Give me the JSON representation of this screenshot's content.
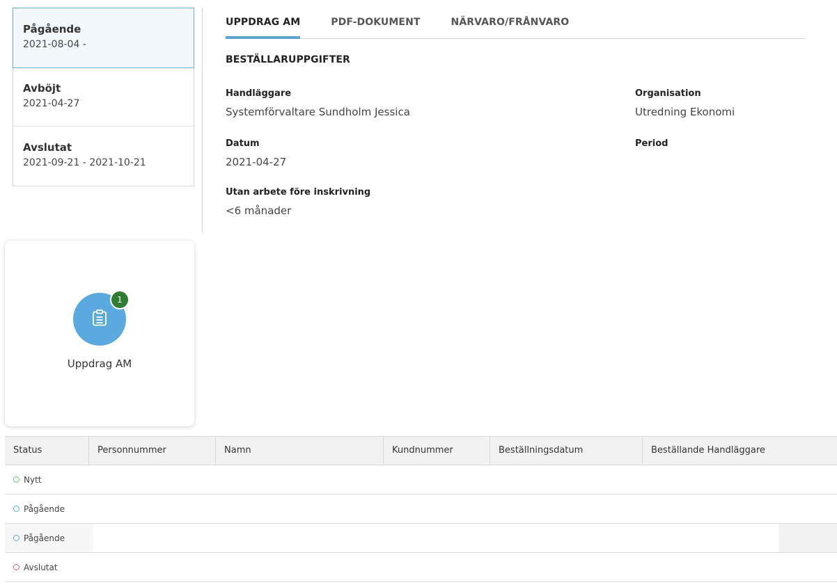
{
  "status_list": [
    {
      "title": "Pågående",
      "date": "2021-08-04 -"
    },
    {
      "title": "Avböjt",
      "date": "2021-04-27"
    },
    {
      "title": "Avslutat",
      "date": "2021-09-21 - 2021-10-21"
    }
  ],
  "tabs": [
    {
      "label": "UPPDRAG AM"
    },
    {
      "label": "PDF-DOKUMENT"
    },
    {
      "label": "NÄRVARO/FRÅNVARO"
    }
  ],
  "section_title": "BESTÄLLARUPPGIFTER",
  "fields": {
    "handlaggare": {
      "label": "Handläggare",
      "value": "Systemförvaltare Sundholm Jessica"
    },
    "organisation": {
      "label": "Organisation",
      "value": "Utredning Ekonomi"
    },
    "datum": {
      "label": "Datum",
      "value": "2021-04-27"
    },
    "period": {
      "label": "Period",
      "value": ""
    },
    "utan_arbete": {
      "label": "Utan arbete före inskrivning",
      "value": "<6 månader"
    }
  },
  "card": {
    "label": "Uppdrag AM",
    "badge": "1",
    "icon": "clipboard-icon"
  },
  "table": {
    "headers": [
      "Status",
      "Personnummer",
      "Namn",
      "Kundnummer",
      "Beställningsdatum",
      "Beställande Handläggare"
    ],
    "rows": [
      {
        "status": "Nytt",
        "color": "#6cc46c"
      },
      {
        "status": "Pågående",
        "color": "#5aaee0"
      },
      {
        "status": "Pågående",
        "color": "#5aaee0"
      },
      {
        "status": "Avslutat",
        "color": "#e0608a"
      }
    ]
  },
  "colors": {
    "accent": "#5aa4cf",
    "badge": "#2f7d32",
    "card_circle": "#5aa9df"
  }
}
